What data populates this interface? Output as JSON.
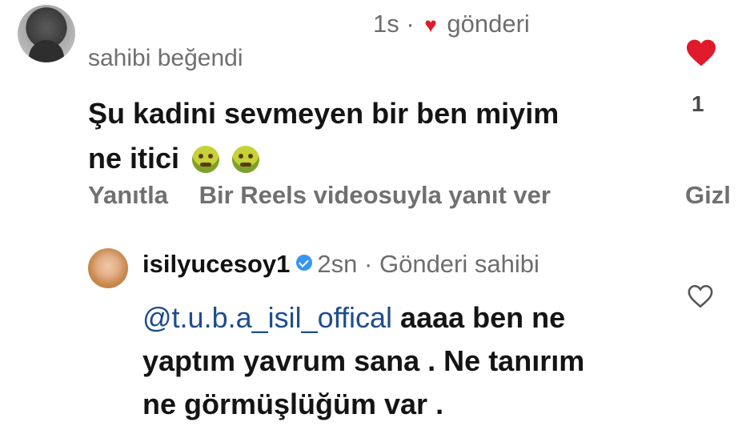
{
  "comment": {
    "time": "1s",
    "separator": "·",
    "post_label": "gönderi",
    "liked_by_owner": "sahibi beğendi",
    "text_line1": "Şu kadini sevmeyen bir ben miyim",
    "text_line2": "ne itici",
    "emoji": "nauseated-face-emoji",
    "like_count": "1",
    "actions": {
      "reply": "Yanıtla",
      "reels_reply": "Bir Reels videosuyla yanıt ver",
      "hide": "Gizl"
    }
  },
  "reply": {
    "username": "isilyucesoy1",
    "time": "2sn",
    "separator": "·",
    "owner_label": "Gönderi sahibi",
    "mention": "@t.u.b.a_isil_offical",
    "text_after_mention": " aaaa ben ne",
    "text_line2": "yaptım yavrum sana . Ne tanırım",
    "text_line3": "ne görmüşlüğüm var ."
  },
  "colors": {
    "heart_red": "#e01a2b",
    "verified_blue": "#3797f0",
    "mention_blue": "#1e4d8c",
    "meta_gray": "#6d6d6d"
  }
}
